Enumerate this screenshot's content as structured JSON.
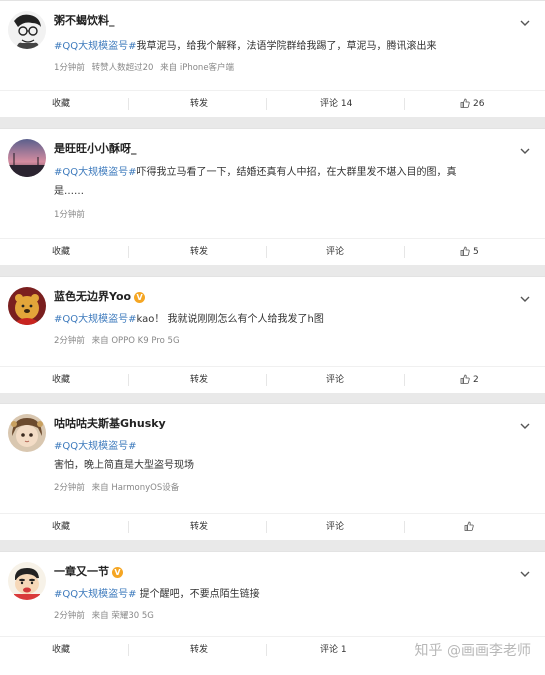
{
  "posts": [
    {
      "username": "粥不蝎饮料_",
      "verified": false,
      "topic": "#QQ大规模盗号#",
      "text": "我草泥马，给我个解释，法语学院群给我踢了，草泥马，腾讯滚出来",
      "text2": "",
      "meta": [
        "1分钟前",
        "转赞人数超过20",
        "来自 iPhone客户端"
      ],
      "actions": {
        "collect": "收藏",
        "repost": "转发",
        "comment": "评论 14",
        "like": "26"
      }
    },
    {
      "username": "是旺旺小小酥呀_",
      "verified": false,
      "topic": "#QQ大规模盗号#",
      "text": "吓得我立马看了一下，结婚还真有人中招，在大群里发不堪入目的图，真",
      "text2": "是……",
      "meta": [
        "1分钟前"
      ],
      "actions": {
        "collect": "收藏",
        "repost": "转发",
        "comment": "评论",
        "like": "5"
      }
    },
    {
      "username": "蓝色无边界Yoo",
      "verified": true,
      "topic": "#QQ大规模盗号#",
      "text": "kao！ 我就说刚刚怎么有个人给我发了h图",
      "text2": "",
      "meta": [
        "2分钟前",
        "来自 OPPO K9 Pro 5G"
      ],
      "actions": {
        "collect": "收藏",
        "repost": "转发",
        "comment": "评论",
        "like": "2"
      }
    },
    {
      "username": "咕咕咕夫斯基Ghusky",
      "verified": false,
      "topic": "#QQ大规模盗号#",
      "text": "",
      "text2": "害怕，晚上简直是大型盗号现场",
      "meta": [
        "2分钟前",
        "来自 HarmonyOS设备"
      ],
      "actions": {
        "collect": "收藏",
        "repost": "转发",
        "comment": "评论",
        "like": ""
      }
    },
    {
      "username": "一章又一节",
      "verified": true,
      "topic": "#QQ大规模盗号#",
      "text": " 提个醒吧，不要点陌生链接",
      "text2": "",
      "meta": [
        "2分钟前",
        "来自 荣耀30 5G"
      ],
      "actions": {
        "collect": "收藏",
        "repost": "转发",
        "comment": "评论 1",
        "like": ""
      }
    }
  ],
  "watermark": "知乎 @画画李老师",
  "colors": {
    "topic": "#3f7bbd",
    "meta": "#888888",
    "badge": "#f5a623",
    "background": "#e9e9e9"
  }
}
